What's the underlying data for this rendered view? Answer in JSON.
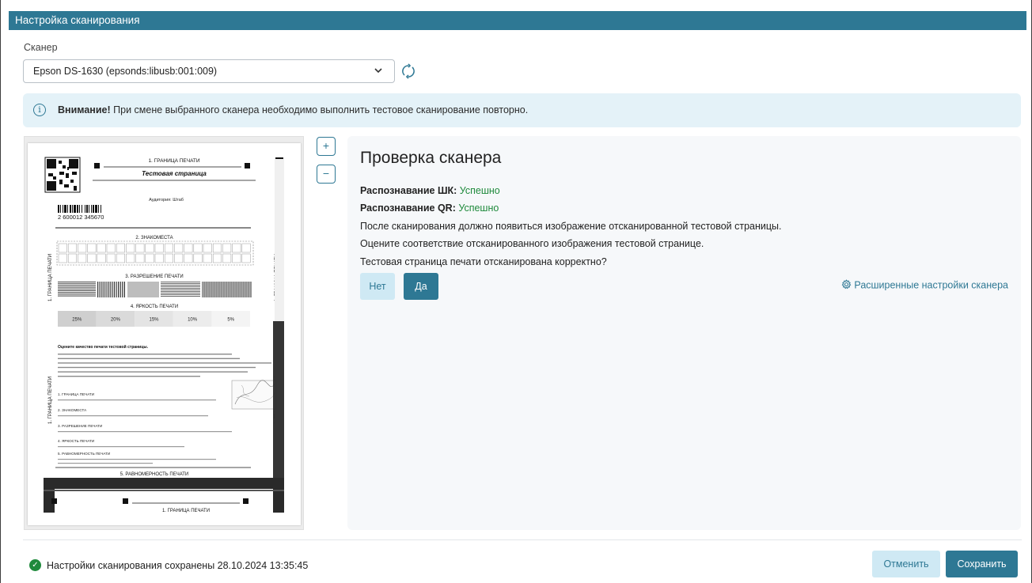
{
  "window": {
    "title": "Настройка сканирования"
  },
  "scanner": {
    "label": "Сканер",
    "selected": "Epson DS-1630 (epsonds:libusb:001:009)",
    "refresh_icon": "refresh-icon",
    "chevron_icon": "chevron-down-icon"
  },
  "alert": {
    "icon": "info-icon",
    "strong": "Внимание!",
    "text": " При смене выбранного сканера необходимо выполнить тестовое сканирование повторно."
  },
  "zoom": {
    "in_label": "+",
    "out_label": "−"
  },
  "preview": {
    "top_border": "1. ГРАНИЦА ПЕЧАТИ",
    "page_title": "Тестовая страница",
    "audience": "Аудитория: Штаб",
    "barcode_digits": "2 600012 345670",
    "section2": "2. ЗНАКОМЕСТА",
    "section3": "3. РАЗРЕШЕНИЕ ПЕЧАТИ",
    "section4": "4. ЯРКОСТЬ ПЕЧАТИ",
    "brightness": [
      "25%",
      "20%",
      "15%",
      "10%",
      "5%"
    ],
    "side_label": "1. ГРАНИЦА ПЕЧАТИ",
    "check_title": "Оцените качество печати тестовой страницы.",
    "item1": "1. ГРАНИЦА ПЕЧАТИ",
    "item2": "2. ЗНАКОМЕСТА",
    "item3": "3. РАЗРЕШЕНИЕ ПЕЧАТИ",
    "item4": "4. ЯРКОСТЬ ПЕЧАТИ",
    "item5": "5. РАВНОМЕРНОСТЬ ПЕЧАТИ",
    "section5": "5. РАВНОМЕРНОСТЬ ПЕЧАТИ",
    "bottom_border": "1. ГРАНИЦА ПЕЧАТИ"
  },
  "check": {
    "title": "Проверка сканера",
    "barcode_label": "Распознавание ШК:",
    "barcode_status": "Успешно",
    "qr_label": "Распознавание QR:",
    "qr_status": "Успешно",
    "line1": "После сканирования должно появиться изображение отсканированной тестовой страницы.",
    "line2": "Оцените соответствие отсканированного изображения тестовой странице.",
    "question": "Тестовая страница печати отсканирована корректно?",
    "no_label": "Нет",
    "yes_label": "Да",
    "advanced_icon": "gear-icon",
    "advanced_label": "Расширенные настройки сканера"
  },
  "footer": {
    "status_icon": "check-circle-icon",
    "status_text": "Настройки сканирования сохранены 28.10.2024 13:35:45",
    "cancel_label": "Отменить",
    "save_label": "Сохранить"
  },
  "colors": {
    "accent": "#2e7894",
    "success": "#1f8a3c",
    "alert_bg": "#e4f2f8",
    "panel_bg": "#f6f8fa"
  }
}
